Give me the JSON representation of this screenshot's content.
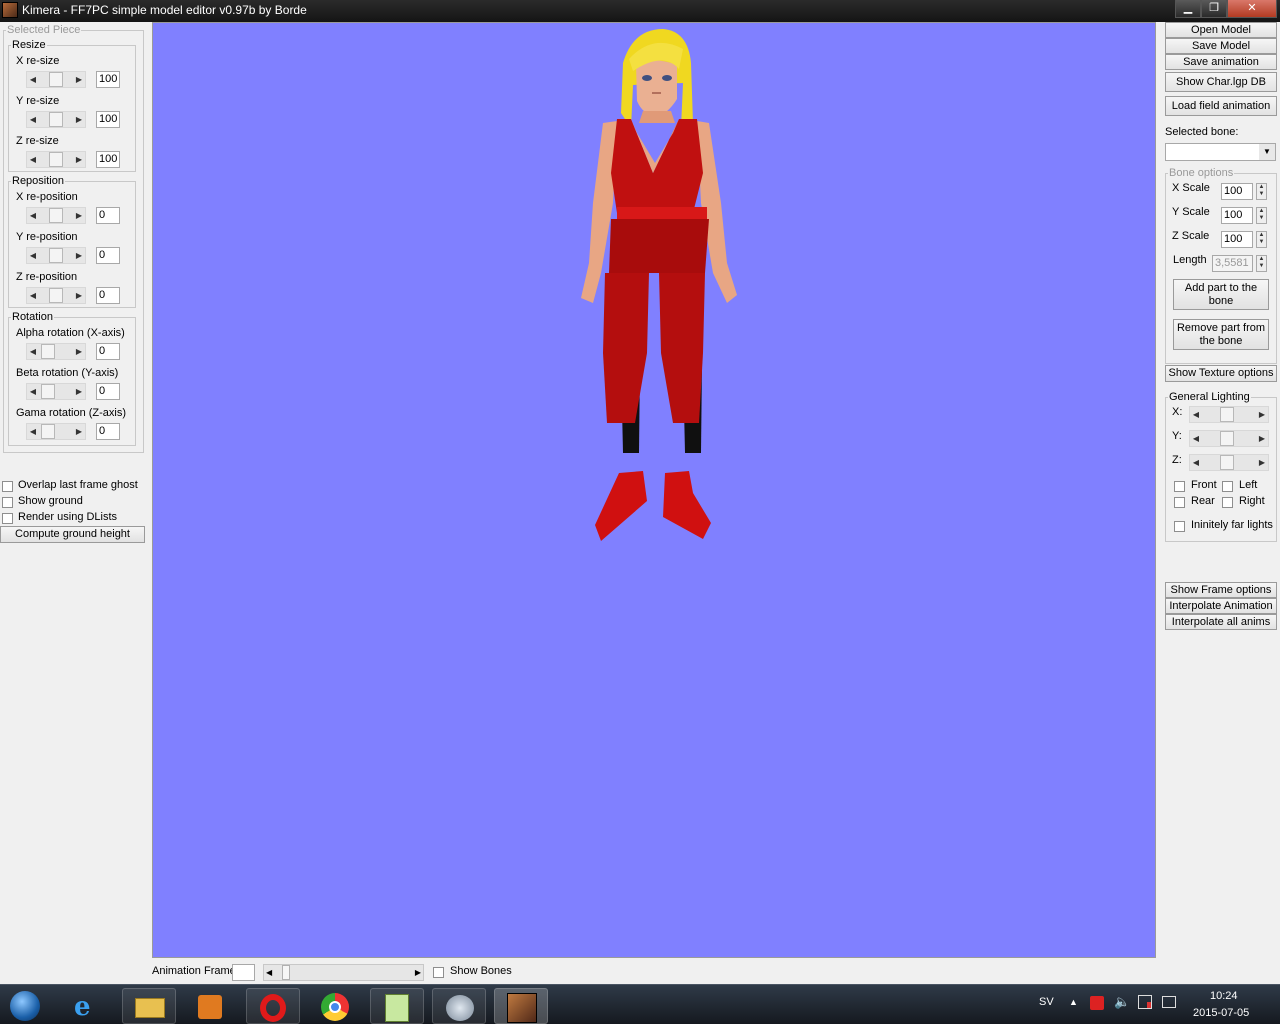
{
  "window": {
    "title": "Kimera - FF7PC simple model editor v0.97b by Borde",
    "min_label": "▁",
    "max_label": "❐",
    "close_label": "✕"
  },
  "selected_piece": {
    "legend": "Selected Piece",
    "resize": {
      "legend": "Resize",
      "x_label": "X re-size",
      "x_value": "100",
      "y_label": "Y re-size",
      "y_value": "100",
      "z_label": "Z re-size",
      "z_value": "100"
    },
    "reposition": {
      "legend": "Reposition",
      "x_label": "X re-position",
      "x_value": "0",
      "y_label": "Y re-position",
      "y_value": "0",
      "z_label": "Z re-position",
      "z_value": "0"
    },
    "rotation": {
      "legend": "Rotation",
      "alpha_label": "Alpha rotation (X-axis)",
      "alpha_value": "0",
      "beta_label": "Beta rotation (Y-axis)",
      "beta_value": "0",
      "gama_label": "Gama rotation (Z-axis)",
      "gama_value": "0"
    }
  },
  "left_options": {
    "overlap_ghost": "Overlap last frame ghost",
    "show_ground": "Show ground",
    "render_dlists": "Render using DLists",
    "compute_ground": "Compute ground height"
  },
  "right_panel": {
    "open_model": "Open Model",
    "save_model": "Save Model",
    "save_animation": "Save animation",
    "show_char_lgp": "Show Char.lgp DB",
    "load_field_anim": "Load field animation",
    "selected_bone_label": "Selected bone:",
    "selected_bone_value": "",
    "bone_options": {
      "legend": "Bone options",
      "x_scale_label": "X Scale",
      "x_scale": "100",
      "y_scale_label": "Y Scale",
      "y_scale": "100",
      "z_scale_label": "Z Scale",
      "z_scale": "100",
      "length_label": "Length",
      "length": "3,5581",
      "add_part": "Add part to the bone",
      "remove_part": "Remove part from the bone"
    },
    "show_texture": "Show Texture options",
    "lighting": {
      "legend": "General Lighting",
      "x_label": "X:",
      "y_label": "Y:",
      "z_label": "Z:",
      "front": "Front",
      "left": "Left",
      "rear": "Rear",
      "right": "Right",
      "infinite": "Ininitely far lights"
    },
    "show_frame": "Show Frame options",
    "interpolate_anim": "Interpolate Animation",
    "interpolate_all": "Interpolate all anims"
  },
  "bottom": {
    "anim_frame_label": "Animation Frame",
    "anim_frame_value": "",
    "show_bones": "Show Bones"
  },
  "colors": {
    "viewport": "#8080ff",
    "hair": "#f0d820",
    "outfit": "#c01010",
    "skin": "#e8a684"
  },
  "taskbar": {
    "apps": [
      "start-orb",
      "internet-explorer",
      "file-explorer",
      "media-player",
      "opera",
      "chrome",
      "notepad-plus",
      "downloader",
      "kimera"
    ],
    "lang": "SV",
    "time": "10:24",
    "date": "2015-07-05"
  }
}
